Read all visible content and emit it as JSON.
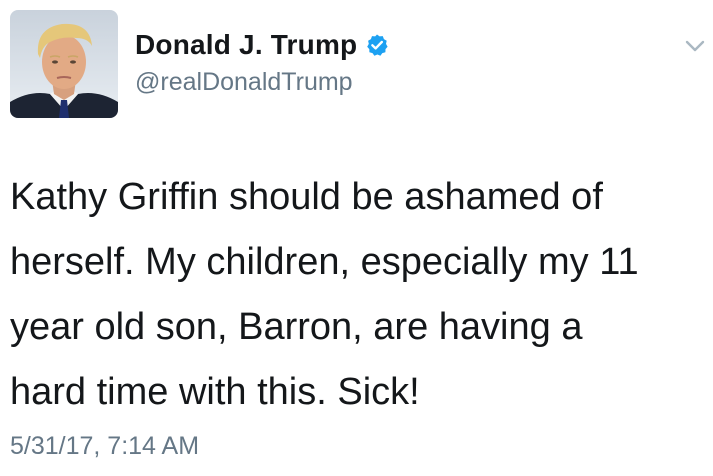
{
  "user": {
    "display_name": "Donald J. Trump",
    "handle": "@realDonaldTrump",
    "verified": true,
    "avatar_icon": "profile-photo",
    "verified_icon": "verified-badge-icon",
    "verified_color": "#1da1f2"
  },
  "tweet": {
    "text": "Kathy Griffin should be ashamed of\nherself. My children, especially my 11\nyear old son, Barron, are having a\nhard time with this. Sick!",
    "timestamp": "5/31/17, 7:14 AM"
  },
  "menu": {
    "icon": "chevron-down-icon"
  },
  "colors": {
    "text": "#14171a",
    "secondary": "#657786",
    "chevron": "#aab8c2"
  }
}
